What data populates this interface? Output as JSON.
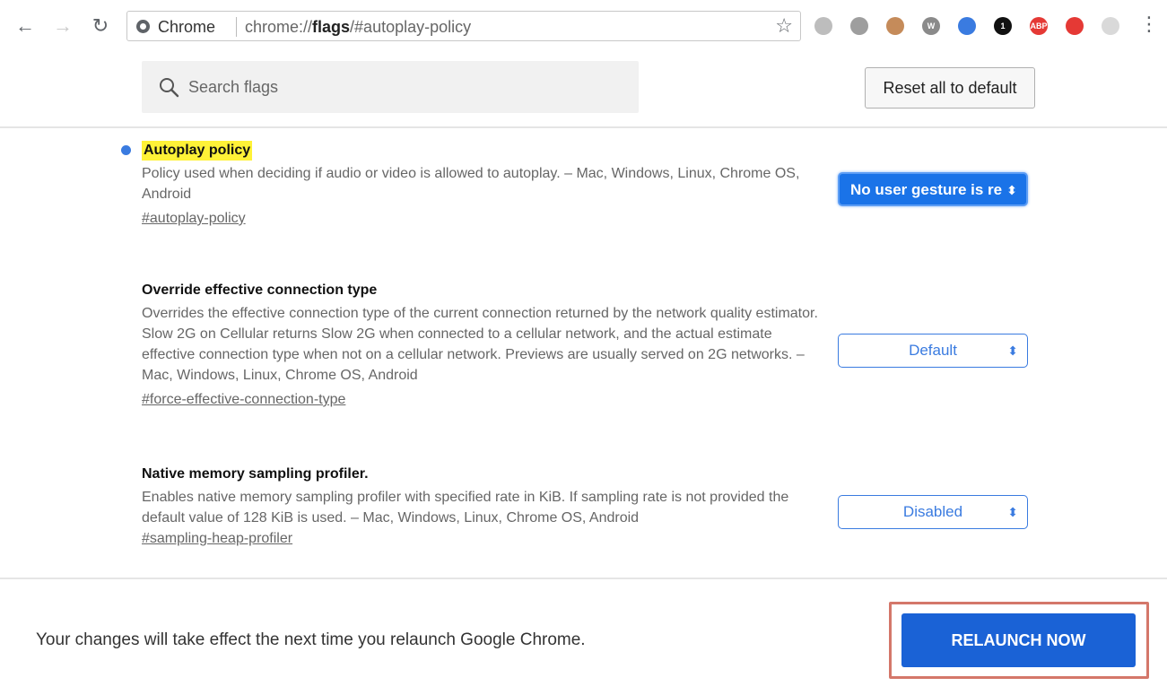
{
  "browser": {
    "site_name": "Chrome",
    "url_prefix": "chrome://",
    "url_host": "flags",
    "url_path": "/#autoplay-policy",
    "extensions": [
      {
        "name": "ext-1",
        "color": "#bdbdbd",
        "label": ""
      },
      {
        "name": "ext-2",
        "color": "#9e9e9e",
        "label": ""
      },
      {
        "name": "ext-3",
        "color": "#c58b5a",
        "label": ""
      },
      {
        "name": "ext-4",
        "color": "#8a8a8a",
        "label": "W"
      },
      {
        "name": "ext-5",
        "color": "#3a7be0",
        "label": ""
      },
      {
        "name": "ext-6",
        "color": "#111111",
        "label": "1"
      },
      {
        "name": "ext-7",
        "color": "#e53935",
        "label": "ABP"
      },
      {
        "name": "ext-8",
        "color": "#e53935",
        "label": ""
      },
      {
        "name": "ext-9",
        "color": "#d9d9d9",
        "label": ""
      }
    ]
  },
  "search": {
    "placeholder": "Search flags"
  },
  "reset_button": "Reset all to default",
  "flags": [
    {
      "title": "Autoplay policy",
      "description": "Policy used when deciding if audio or video is allowed to autoplay. – Mac, Windows, Linux, Chrome OS, Android",
      "link": "#autoplay-policy",
      "selected": "No user gesture is re"
    },
    {
      "title": "Override effective connection type",
      "description": "Overrides the effective connection type of the current connection returned by the network quality estimator. Slow 2G on Cellular returns Slow 2G when connected to a cellular network, and the actual estimate effective connection type when not on a cellular network. Previews are usually served on 2G networks. – Mac, Windows, Linux, Chrome OS, Android",
      "link": "#force-effective-connection-type",
      "selected": "Default"
    },
    {
      "title": "Native memory sampling profiler.",
      "description": "Enables native memory sampling profiler with specified rate in KiB. If sampling rate is not provided the default value of 128 KiB is used. – Mac, Windows, Linux, Chrome OS, Android",
      "link": "#sampling-heap-profiler",
      "selected": "Disabled"
    }
  ],
  "footer": {
    "message": "Your changes will take effect the next time you relaunch Google Chrome.",
    "relaunch_label": "RELAUNCH NOW"
  },
  "colors": {
    "accent": "#1a73e8",
    "highlight": "#fff237",
    "callout": "#d4776a"
  }
}
